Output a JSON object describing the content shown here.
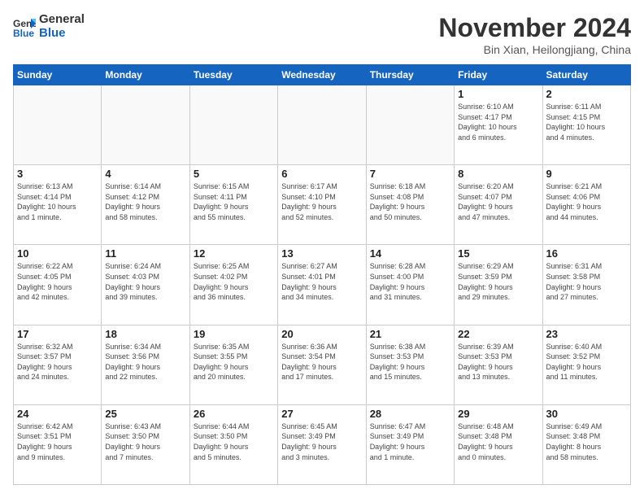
{
  "logo": {
    "line1": "General",
    "line2": "Blue"
  },
  "title": "November 2024",
  "subtitle": "Bin Xian, Heilongjiang, China",
  "days_of_week": [
    "Sunday",
    "Monday",
    "Tuesday",
    "Wednesday",
    "Thursday",
    "Friday",
    "Saturday"
  ],
  "weeks": [
    [
      {
        "day": "",
        "info": ""
      },
      {
        "day": "",
        "info": ""
      },
      {
        "day": "",
        "info": ""
      },
      {
        "day": "",
        "info": ""
      },
      {
        "day": "",
        "info": ""
      },
      {
        "day": "1",
        "info": "Sunrise: 6:10 AM\nSunset: 4:17 PM\nDaylight: 10 hours\nand 6 minutes."
      },
      {
        "day": "2",
        "info": "Sunrise: 6:11 AM\nSunset: 4:15 PM\nDaylight: 10 hours\nand 4 minutes."
      }
    ],
    [
      {
        "day": "3",
        "info": "Sunrise: 6:13 AM\nSunset: 4:14 PM\nDaylight: 10 hours\nand 1 minute."
      },
      {
        "day": "4",
        "info": "Sunrise: 6:14 AM\nSunset: 4:12 PM\nDaylight: 9 hours\nand 58 minutes."
      },
      {
        "day": "5",
        "info": "Sunrise: 6:15 AM\nSunset: 4:11 PM\nDaylight: 9 hours\nand 55 minutes."
      },
      {
        "day": "6",
        "info": "Sunrise: 6:17 AM\nSunset: 4:10 PM\nDaylight: 9 hours\nand 52 minutes."
      },
      {
        "day": "7",
        "info": "Sunrise: 6:18 AM\nSunset: 4:08 PM\nDaylight: 9 hours\nand 50 minutes."
      },
      {
        "day": "8",
        "info": "Sunrise: 6:20 AM\nSunset: 4:07 PM\nDaylight: 9 hours\nand 47 minutes."
      },
      {
        "day": "9",
        "info": "Sunrise: 6:21 AM\nSunset: 4:06 PM\nDaylight: 9 hours\nand 44 minutes."
      }
    ],
    [
      {
        "day": "10",
        "info": "Sunrise: 6:22 AM\nSunset: 4:05 PM\nDaylight: 9 hours\nand 42 minutes."
      },
      {
        "day": "11",
        "info": "Sunrise: 6:24 AM\nSunset: 4:03 PM\nDaylight: 9 hours\nand 39 minutes."
      },
      {
        "day": "12",
        "info": "Sunrise: 6:25 AM\nSunset: 4:02 PM\nDaylight: 9 hours\nand 36 minutes."
      },
      {
        "day": "13",
        "info": "Sunrise: 6:27 AM\nSunset: 4:01 PM\nDaylight: 9 hours\nand 34 minutes."
      },
      {
        "day": "14",
        "info": "Sunrise: 6:28 AM\nSunset: 4:00 PM\nDaylight: 9 hours\nand 31 minutes."
      },
      {
        "day": "15",
        "info": "Sunrise: 6:29 AM\nSunset: 3:59 PM\nDaylight: 9 hours\nand 29 minutes."
      },
      {
        "day": "16",
        "info": "Sunrise: 6:31 AM\nSunset: 3:58 PM\nDaylight: 9 hours\nand 27 minutes."
      }
    ],
    [
      {
        "day": "17",
        "info": "Sunrise: 6:32 AM\nSunset: 3:57 PM\nDaylight: 9 hours\nand 24 minutes."
      },
      {
        "day": "18",
        "info": "Sunrise: 6:34 AM\nSunset: 3:56 PM\nDaylight: 9 hours\nand 22 minutes."
      },
      {
        "day": "19",
        "info": "Sunrise: 6:35 AM\nSunset: 3:55 PM\nDaylight: 9 hours\nand 20 minutes."
      },
      {
        "day": "20",
        "info": "Sunrise: 6:36 AM\nSunset: 3:54 PM\nDaylight: 9 hours\nand 17 minutes."
      },
      {
        "day": "21",
        "info": "Sunrise: 6:38 AM\nSunset: 3:53 PM\nDaylight: 9 hours\nand 15 minutes."
      },
      {
        "day": "22",
        "info": "Sunrise: 6:39 AM\nSunset: 3:53 PM\nDaylight: 9 hours\nand 13 minutes."
      },
      {
        "day": "23",
        "info": "Sunrise: 6:40 AM\nSunset: 3:52 PM\nDaylight: 9 hours\nand 11 minutes."
      }
    ],
    [
      {
        "day": "24",
        "info": "Sunrise: 6:42 AM\nSunset: 3:51 PM\nDaylight: 9 hours\nand 9 minutes."
      },
      {
        "day": "25",
        "info": "Sunrise: 6:43 AM\nSunset: 3:50 PM\nDaylight: 9 hours\nand 7 minutes."
      },
      {
        "day": "26",
        "info": "Sunrise: 6:44 AM\nSunset: 3:50 PM\nDaylight: 9 hours\nand 5 minutes."
      },
      {
        "day": "27",
        "info": "Sunrise: 6:45 AM\nSunset: 3:49 PM\nDaylight: 9 hours\nand 3 minutes."
      },
      {
        "day": "28",
        "info": "Sunrise: 6:47 AM\nSunset: 3:49 PM\nDaylight: 9 hours\nand 1 minute."
      },
      {
        "day": "29",
        "info": "Sunrise: 6:48 AM\nSunset: 3:48 PM\nDaylight: 9 hours\nand 0 minutes."
      },
      {
        "day": "30",
        "info": "Sunrise: 6:49 AM\nSunset: 3:48 PM\nDaylight: 8 hours\nand 58 minutes."
      }
    ]
  ]
}
